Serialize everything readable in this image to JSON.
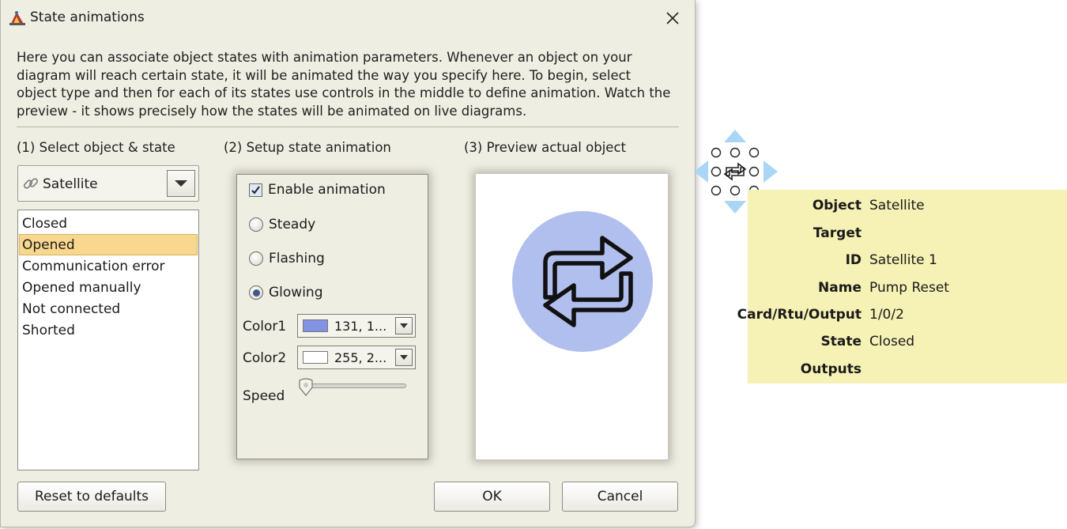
{
  "window": {
    "title": "State animations",
    "description": "Here you can associate object states with animation parameters. Whenever an object on your diagram will reach certain state, it will be animated the way you specify here. To begin, select object type and then for each of its states use controls in the middle to define animation. Watch the preview - it shows precisely how the states will be animated on live diagrams."
  },
  "sections": {
    "select": "(1) Select object & state",
    "setup": "(2) Setup state animation",
    "preview": "(3) Preview actual object"
  },
  "object_type": {
    "selected": "Satellite"
  },
  "states": [
    {
      "label": "Closed",
      "selected": false
    },
    {
      "label": "Opened",
      "selected": true
    },
    {
      "label": "Communication error",
      "selected": false
    },
    {
      "label": "Opened manually",
      "selected": false
    },
    {
      "label": "Not connected",
      "selected": false
    },
    {
      "label": "Shorted",
      "selected": false
    }
  ],
  "animation": {
    "enable_label": "Enable animation",
    "enabled": true,
    "modes": [
      {
        "label": "Steady",
        "selected": false
      },
      {
        "label": "Flashing",
        "selected": false
      },
      {
        "label": "Glowing",
        "selected": true
      }
    ],
    "color1": {
      "label": "Color1",
      "value": "131, 1...",
      "swatch": "#8393e3"
    },
    "color2": {
      "label": "Color2",
      "value": "255, 2...",
      "swatch": "#ffffff"
    },
    "speed": {
      "label": "Speed",
      "level": 0
    }
  },
  "preview_object": {
    "fill": "#b1bfee",
    "icon": "repeat-arrows-icon"
  },
  "buttons": {
    "reset": "Reset to defaults",
    "ok": "OK",
    "cancel": "Cancel"
  },
  "info_panel": {
    "rows": [
      {
        "key": "Object",
        "value": "Satellite"
      },
      {
        "key": "Target",
        "value": ""
      },
      {
        "key": "ID",
        "value": "Satellite 1"
      },
      {
        "key": "Name",
        "value": "Pump Reset"
      },
      {
        "key": "Card/Rtu/Output",
        "value": "1/0/2"
      },
      {
        "key": "State",
        "value": "Closed"
      },
      {
        "key": "Outputs",
        "value": ""
      }
    ]
  },
  "colors": {
    "dialog_bg": "#efeee3",
    "selection": "#f8d78e",
    "info_bg": "#f6f1b5",
    "move_arrows": "#a9d6f4"
  }
}
